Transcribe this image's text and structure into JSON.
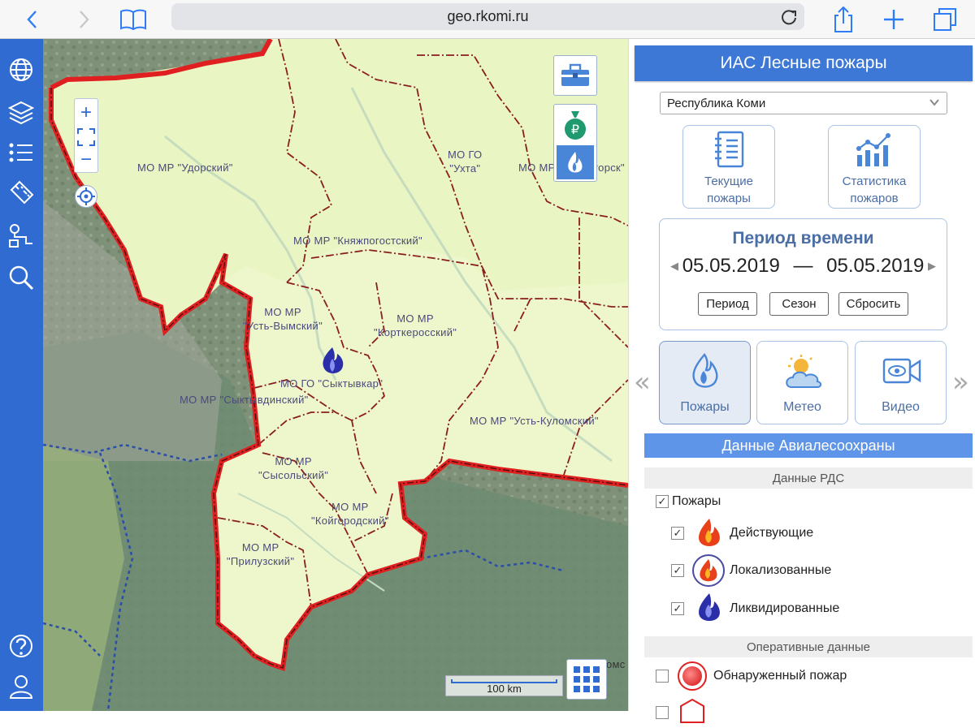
{
  "browser": {
    "url": "geo.rkomi.ru",
    "icons": [
      "back-icon",
      "forward-icon",
      "bookmarks-icon",
      "reload-icon",
      "share-icon",
      "new-tab-icon",
      "tabs-icon"
    ]
  },
  "sidebar": {
    "top_icons": [
      "globe-icon",
      "layers-icon",
      "list-icon",
      "ruler-icon",
      "route-icon",
      "search-icon"
    ],
    "bottom_icons": [
      "help-icon",
      "user-icon"
    ]
  },
  "map": {
    "labels": {
      "udorsky": "МО МР \"Удорский\"",
      "ukhta": "МО ГО\n\"Ухта\"",
      "sosnogorsk": "МО МР \"Сосногорск\"",
      "knyazh": "МО МР \"Княжпогостский\"",
      "ustvym": "МО МР\n\"Усть-Вымский\"",
      "kortker": "МО МР\n\"Корткеросский\"",
      "syktyvkar": "МО ГО \"Сыктывкар\"",
      "syktyvdin": "МО МР \"Сыктывдинский\"",
      "ustkulom": "МО МР \"Усть-Куломский\"",
      "sysol": "МО МР\n\"Сысольский\"",
      "koygorod": "МО МР\n\"Койгородский\"",
      "priluz": "МО МР\n\"Прилузский\"",
      "komsom": "омс"
    },
    "scale": "100 km",
    "zoom_in": "+",
    "zoom_out": "−"
  },
  "panel": {
    "title": "ИАС Лесные пожары",
    "region": "Республика Коми",
    "cards": {
      "current_fires": "Текущие\nпожары",
      "fire_stats": "Статистика\nпожаров"
    },
    "period": {
      "title": "Период времени",
      "date_from": "05.05.2019",
      "separator": "—",
      "date_to": "05.05.2019",
      "buttons": {
        "period": "Период",
        "season": "Сезон",
        "reset": "Сбросить"
      }
    },
    "tabs": {
      "fires": "Пожары",
      "meteo": "Метео",
      "video": "Видео"
    },
    "section_header": "Данные Авиалесоохраны",
    "rds_header": "Данные РДС",
    "fires_group": "Пожары",
    "fire_items": {
      "active": "Действующие",
      "localized": "Локализованные",
      "liquidated": "Ликвидированные"
    },
    "operational_header": "Оперативные данные",
    "detected_fire": "Обнаруженный пожар"
  },
  "colors": {
    "accent": "#3d78d6",
    "sidebar": "#2f6bd0",
    "border_red": "#e02020",
    "region_fill": "#eef7cc"
  }
}
